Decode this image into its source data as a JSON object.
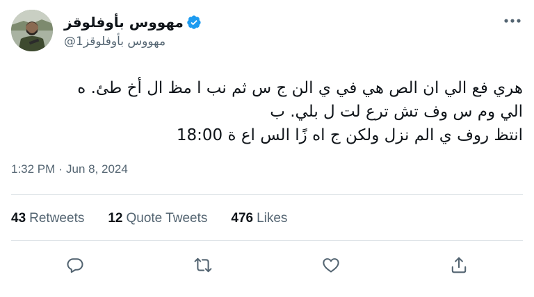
{
  "author": {
    "display_name": "مهووس بأوفلوقز",
    "handle": "@مهووس بأوفلوقز1",
    "verified": true
  },
  "tweet": {
    "lines": [
      "هري فع الي ان الص هي في ي الن ج س ثم نب ا مظ ال أخ طئ. ه",
      "الي وم س وف تش ترع لت ل بلي. ب",
      "انتظ روف ي الم نزل ولكن ج اه زًا الس اع ة 18:00"
    ],
    "time": "1:32 PM",
    "separator": "·",
    "date": "Jun 8, 2024"
  },
  "stats": [
    {
      "count": "43",
      "label": "Retweets"
    },
    {
      "count": "12",
      "label": "Quote Tweets"
    },
    {
      "count": "476",
      "label": "Likes"
    }
  ],
  "icons": {
    "more": "more-horizontal-icon",
    "reply": "reply-icon",
    "retweet": "retweet-icon",
    "like": "heart-icon",
    "share": "share-icon",
    "verified": "verified-badge-icon"
  },
  "colors": {
    "text": "#0f1419",
    "secondary": "#536471",
    "verified": "#1d9bf0",
    "divider": "#dfe4e8"
  }
}
